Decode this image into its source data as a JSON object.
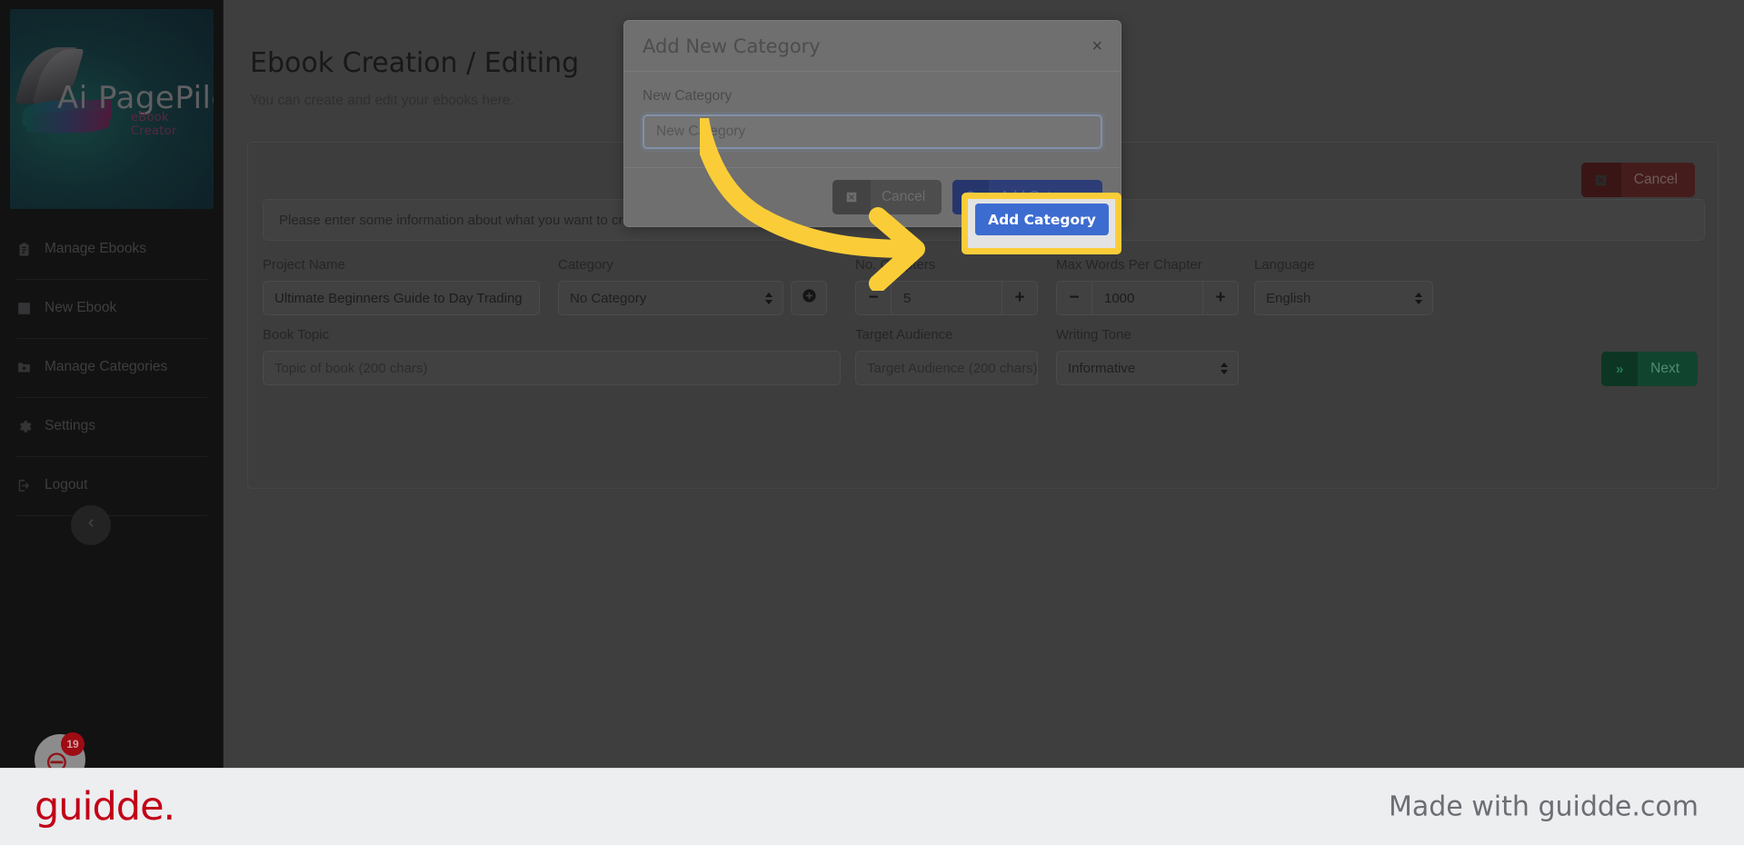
{
  "sidebar": {
    "logo": {
      "brand": "Ai PagePilot",
      "tagline": "eBook Creator"
    },
    "items": [
      {
        "label": "Manage Ebooks",
        "icon": "clipboard-list-icon"
      },
      {
        "label": "New Ebook",
        "icon": "book-icon"
      },
      {
        "label": "Manage Categories",
        "icon": "folder-plus-icon"
      },
      {
        "label": "Settings",
        "icon": "gear-icon"
      },
      {
        "label": "Logout",
        "icon": "logout-icon"
      }
    ],
    "collapse_icon": "chevron-left-icon",
    "chat_badge_count": "19"
  },
  "main": {
    "title": "Ebook Creation / Editing",
    "subtitle": "You can create and edit your ebooks here.",
    "cancel_label": "Cancel",
    "cancel_icon": "close-box-icon",
    "info_text": "Please enter some information about what you want to create and click Next",
    "fields": {
      "project_name": {
        "label": "Project Name",
        "value": "Ultimate Beginners Guide to Day Trading"
      },
      "category": {
        "label": "Category",
        "value": "No Category",
        "add_icon": "plus-circle-icon"
      },
      "no_chapters": {
        "label": "No. Chapters",
        "value": "5",
        "minus": "−",
        "plus": "+"
      },
      "max_words": {
        "label": "Max Words Per Chapter",
        "value": "1000",
        "minus": "−",
        "plus": "+"
      },
      "language": {
        "label": "Language",
        "value": "English"
      },
      "book_topic": {
        "label": "Book Topic",
        "placeholder": "Topic of book (200 chars)"
      },
      "target_audience": {
        "label": "Target Audience",
        "placeholder": "Target Audience (200 chars)"
      },
      "writing_tone": {
        "label": "Writing Tone",
        "value": "Informative"
      }
    },
    "next_label": "Next",
    "next_icon": "chevron-double-right-icon"
  },
  "modal": {
    "title": "Add New Category",
    "close_icon": "close-icon",
    "field_label": "New Category",
    "input_placeholder": "New Category",
    "input_value": "",
    "cancel_label": "Cancel",
    "cancel_icon": "close-box-icon",
    "add_label": "Add Category",
    "add_icon": "plus-circle-icon"
  },
  "highlight": {
    "button_label": "Add Category",
    "border_color": "#facd38"
  },
  "footer": {
    "logo_text": "guidde.",
    "made_with": "Made with guidde.com",
    "logo_color": "#c20017"
  }
}
